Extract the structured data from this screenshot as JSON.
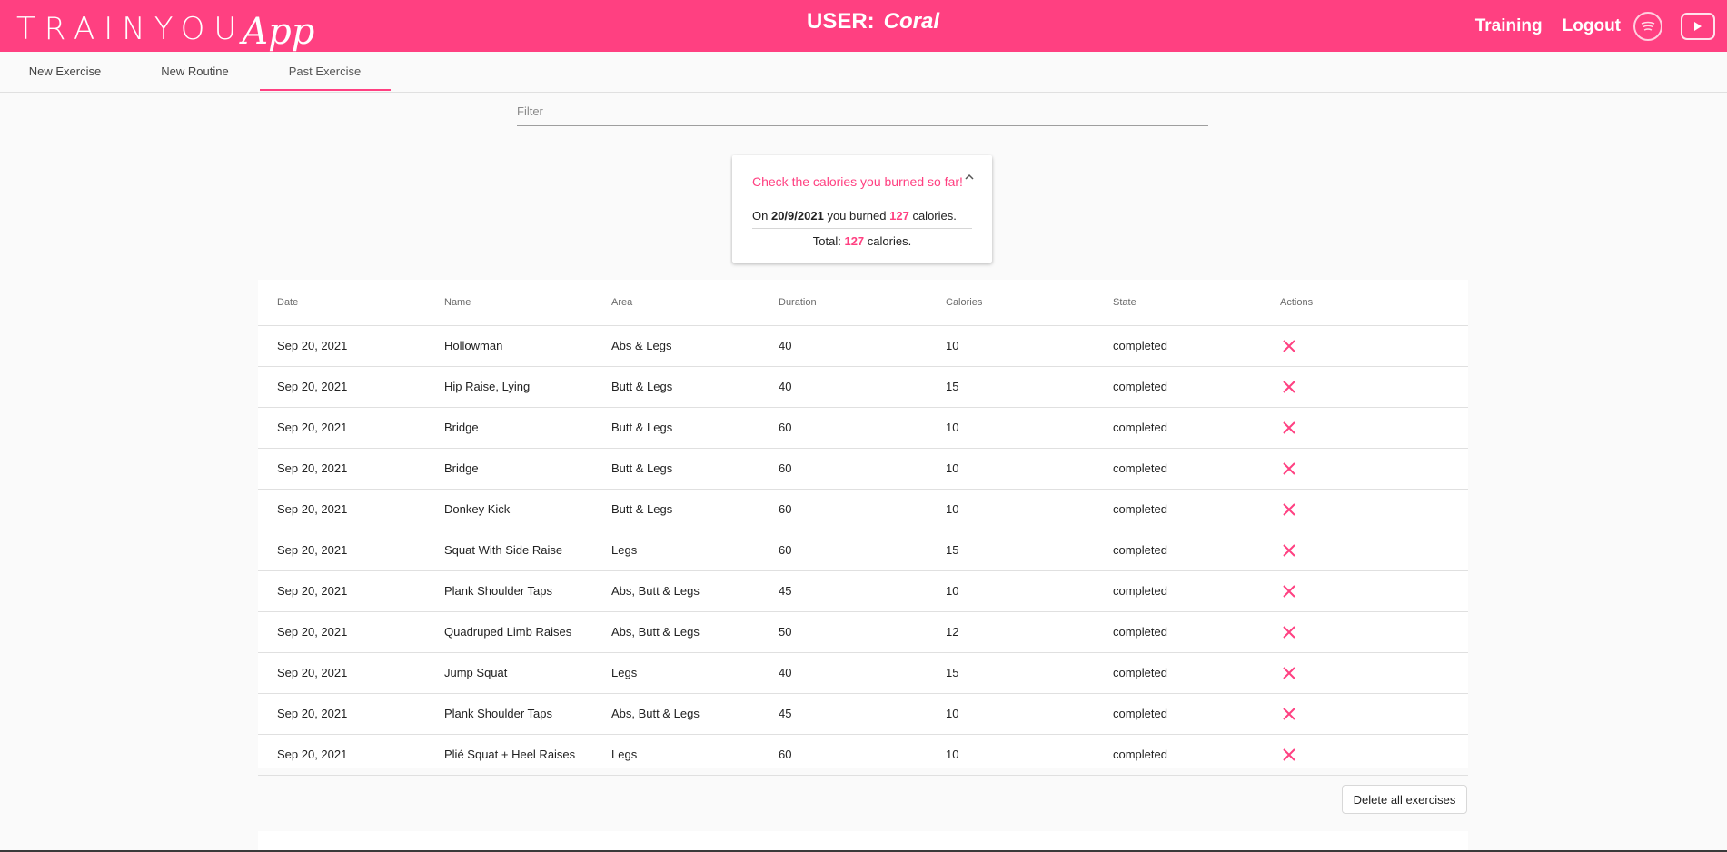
{
  "header": {
    "brand": "TRAINYOU",
    "brand_app": "App",
    "user_label": "USER:",
    "user_name": "Coral",
    "nav": [
      "Training",
      "Logout"
    ],
    "icons": [
      "spotify-icon",
      "youtube-icon"
    ],
    "accent_color": "#ff4081"
  },
  "tabs": [
    {
      "label": "New Exercise"
    },
    {
      "label": "New Routine"
    },
    {
      "label": "Past Exercise",
      "active": true
    }
  ],
  "filter": {
    "placeholder": "Filter",
    "value": ""
  },
  "calories": {
    "title": "Check the calories you burned so far!",
    "entry_prefix": "On",
    "date": "20/9/2021",
    "entry_middle": "you burned",
    "amount": "127",
    "entry_suffix": "calories.",
    "total_label": "Total:",
    "total_amount": "127",
    "total_suffix": "calories."
  },
  "table": {
    "columns": [
      "Date",
      "Name",
      "Area",
      "Duration",
      "Calories",
      "State",
      "Actions"
    ],
    "rows": [
      [
        "Sep 20, 2021",
        "Hollowman",
        "Abs & Legs",
        "40",
        "10",
        "completed"
      ],
      [
        "Sep 20, 2021",
        "Hip Raise, Lying",
        "Butt & Legs",
        "40",
        "15",
        "completed"
      ],
      [
        "Sep 20, 2021",
        "Bridge",
        "Butt & Legs",
        "60",
        "10",
        "completed"
      ],
      [
        "Sep 20, 2021",
        "Bridge",
        "Butt & Legs",
        "60",
        "10",
        "completed"
      ],
      [
        "Sep 20, 2021",
        "Donkey Kick",
        "Butt & Legs",
        "60",
        "10",
        "completed"
      ],
      [
        "Sep 20, 2021",
        "Squat With Side Raise",
        "Legs",
        "60",
        "15",
        "completed"
      ],
      [
        "Sep 20, 2021",
        "Plank Shoulder Taps",
        "Abs, Butt & Legs",
        "45",
        "10",
        "completed"
      ],
      [
        "Sep 20, 2021",
        "Quadruped Limb Raises",
        "Abs, Butt & Legs",
        "50",
        "12",
        "completed"
      ],
      [
        "Sep 20, 2021",
        "Jump Squat",
        "Legs",
        "40",
        "15",
        "completed"
      ],
      [
        "Sep 20, 2021",
        "Plank Shoulder Taps",
        "Abs, Butt & Legs",
        "45",
        "10",
        "completed"
      ],
      [
        "Sep 20, 2021",
        "Plié Squat + Heel Raises",
        "Legs",
        "60",
        "10",
        "completed"
      ]
    ],
    "row_action_icon": "close-icon"
  },
  "actions": {
    "delete_all_label": "Delete all exercises"
  }
}
